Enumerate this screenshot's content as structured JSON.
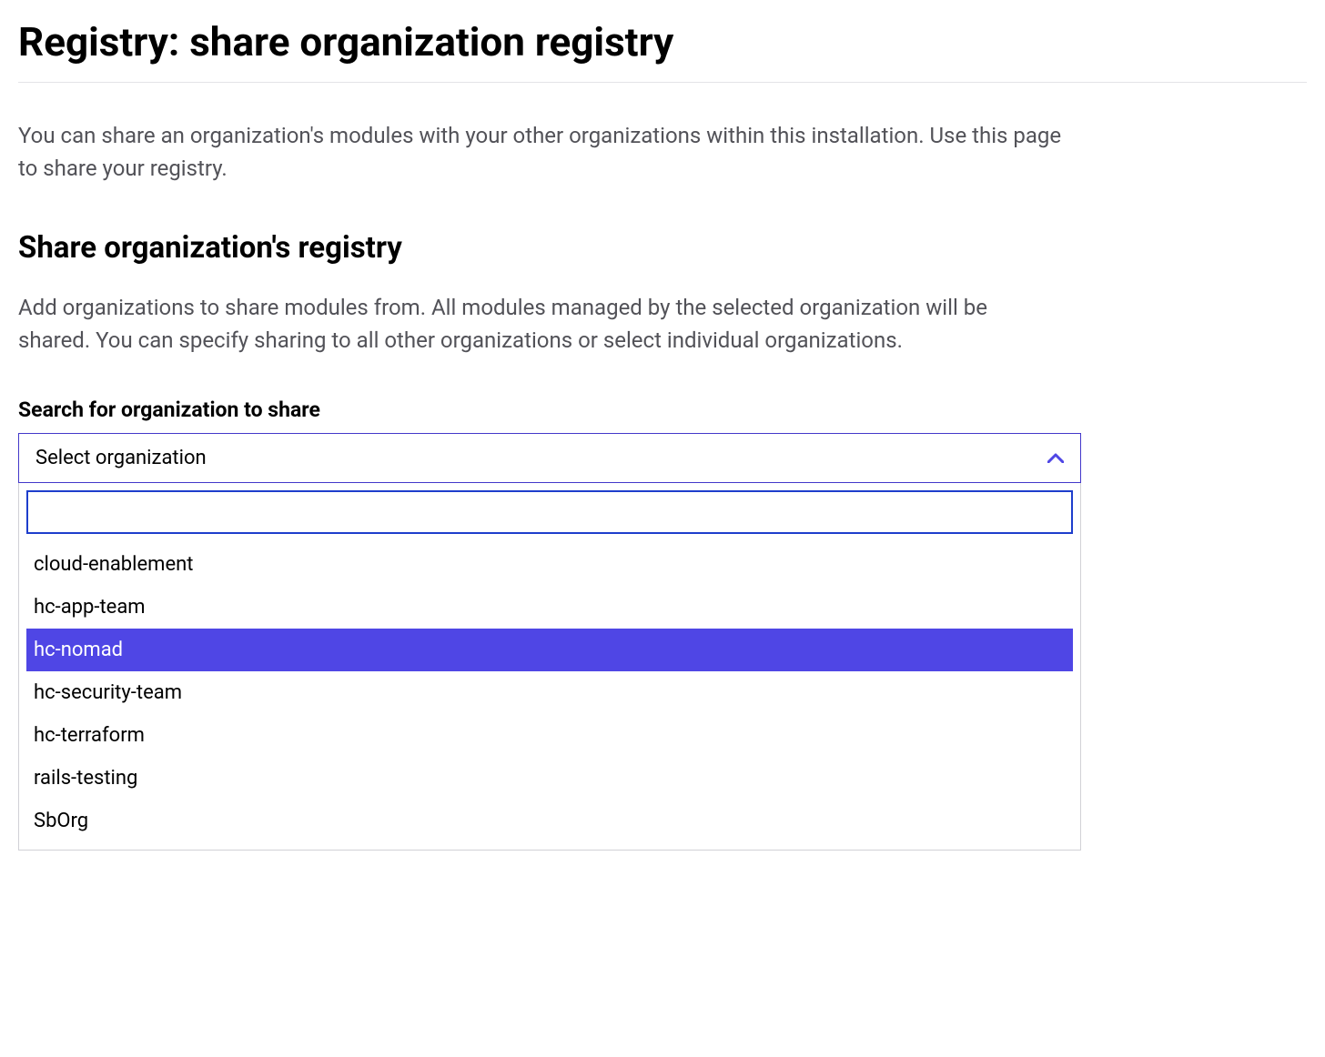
{
  "page": {
    "title": "Registry: share organization registry",
    "description": "You can share an organization's modules with your other organizations within this installation. Use this page to share your registry."
  },
  "section": {
    "title": "Share organization's registry",
    "description": "Add organizations to share modules from. All modules managed by the selected organization will be shared. You can specify sharing to all other organizations or select individual organizations."
  },
  "select": {
    "label": "Search for organization to share",
    "placeholder": "Select organization",
    "search_value": "",
    "options": [
      {
        "label": "cloud-enablement",
        "highlighted": false
      },
      {
        "label": "hc-app-team",
        "highlighted": false
      },
      {
        "label": "hc-nomad",
        "highlighted": true
      },
      {
        "label": "hc-security-team",
        "highlighted": false
      },
      {
        "label": "hc-terraform",
        "highlighted": false
      },
      {
        "label": "rails-testing",
        "highlighted": false
      },
      {
        "label": "SbOrg",
        "highlighted": false
      }
    ]
  },
  "colors": {
    "highlight": "#4f46e5",
    "border_active": "#4338ca",
    "text_muted": "#525258"
  }
}
